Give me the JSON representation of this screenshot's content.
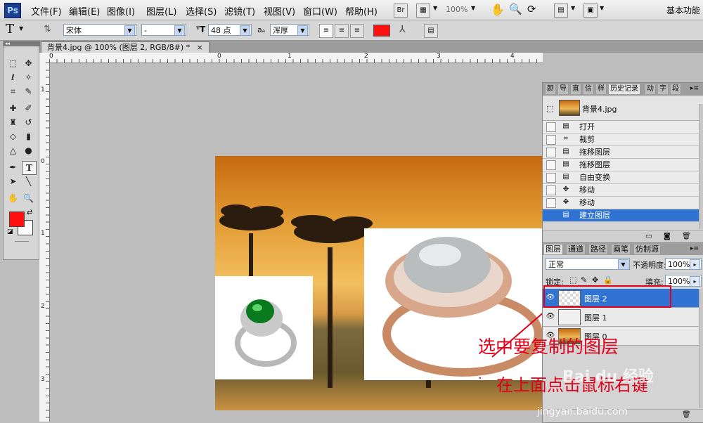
{
  "app": {
    "logo": "Ps"
  },
  "menu": [
    "文件(F)",
    "编辑(E)",
    "图像(I)",
    "图层(L)",
    "选择(S)",
    "滤镜(T)",
    "视图(V)",
    "窗口(W)",
    "帮助(H)"
  ],
  "toolbar": {
    "br_label": "Br",
    "zoom": "100%",
    "workspace": "基本功能"
  },
  "options": {
    "tool_glyph": "T",
    "font_family": "宋体",
    "font_style": "-",
    "font_size": "48 点",
    "aa_label": "aₐ",
    "antialias": "浑厚",
    "text_color": "#ff1111"
  },
  "document": {
    "tab_title": "背景4.jpg @ 100% (图层 2, RGB/8#) *",
    "close": "×"
  },
  "rulers": {
    "h": [
      "0",
      "1",
      "2",
      "3",
      "4",
      "5",
      "6"
    ],
    "v": [
      "1",
      "0",
      "1",
      "2",
      "3"
    ]
  },
  "colors": {
    "foreground": "#ff1111",
    "background": "#ffffff",
    "selection": "#3173d2",
    "annotation": "#e0001a"
  },
  "history_panel": {
    "tabs": [
      "颜",
      "导",
      "直",
      "信",
      "样",
      "历史记录",
      "动",
      "字",
      "段"
    ],
    "snapshot": "背景4.jpg",
    "items": [
      {
        "label": "打开",
        "icon": "doc-icon",
        "selected": false
      },
      {
        "label": "裁剪",
        "icon": "crop-icon",
        "selected": false
      },
      {
        "label": "拖移图层",
        "icon": "doc-icon",
        "selected": false
      },
      {
        "label": "拖移图层",
        "icon": "doc-icon",
        "selected": false
      },
      {
        "label": "自由变换",
        "icon": "doc-icon",
        "selected": false
      },
      {
        "label": "移动",
        "icon": "move-icon",
        "selected": false
      },
      {
        "label": "移动",
        "icon": "move-icon",
        "selected": false
      },
      {
        "label": "建立图层",
        "icon": "doc-icon",
        "selected": true
      }
    ]
  },
  "layers_panel": {
    "tabs": [
      "图层",
      "通道",
      "路径",
      "画笔",
      "仿制源"
    ],
    "blend_mode": "正常",
    "opacity_label": "不透明度:",
    "opacity": "100%",
    "lock_label": "锁定:",
    "fill_label": "填充:",
    "fill": "100%",
    "layers": [
      {
        "name": "图层 2",
        "selected": true
      },
      {
        "name": "图层 1",
        "selected": false
      },
      {
        "name": "图层 0",
        "selected": false
      }
    ]
  },
  "annotations": {
    "line1": "选中要复制的图层",
    "line2": "在上面点击鼠标右键",
    "bullet": "·"
  },
  "watermark": {
    "logo": "Bai du 经验",
    "url": "jingyan.baidu.com"
  }
}
